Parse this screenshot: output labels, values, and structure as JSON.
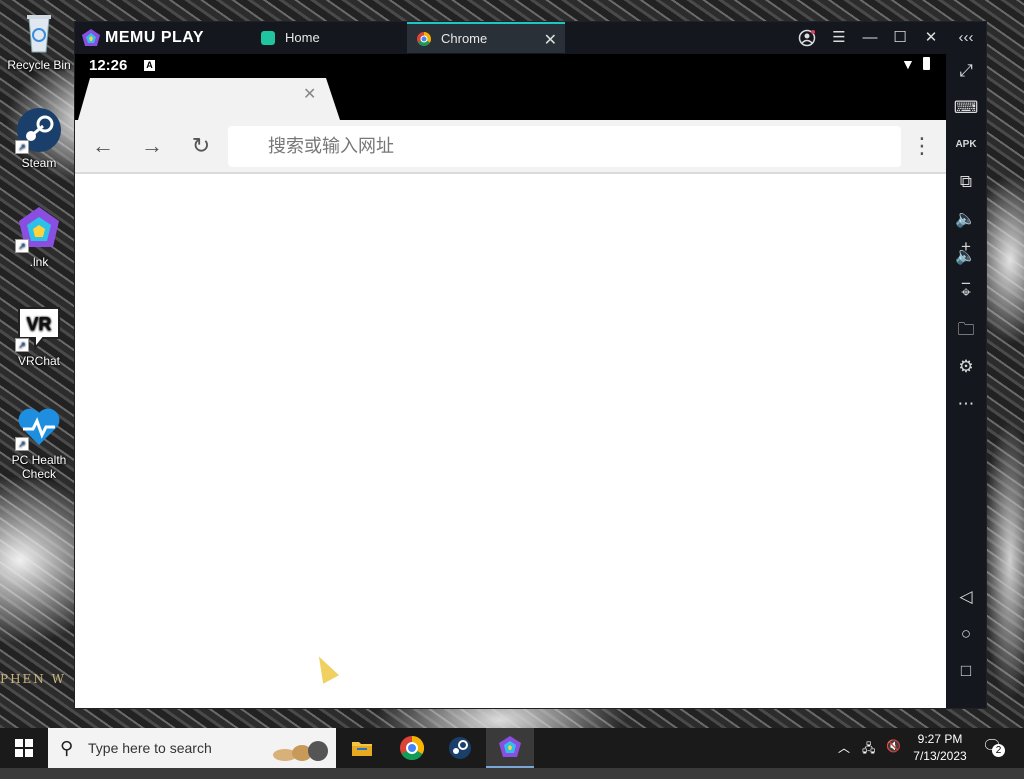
{
  "desktop": {
    "icons": [
      {
        "label": "Recycle Bin"
      },
      {
        "label": "Steam"
      },
      {
        "label": ".lnk"
      },
      {
        "label": "VRChat"
      },
      {
        "label": "PC Health Check"
      }
    ],
    "wallpaper_text": "PHEN W"
  },
  "memu": {
    "logo_text": "MEMU PLAY",
    "tabs": [
      {
        "label": "Home",
        "active": false
      },
      {
        "label": "Chrome",
        "active": true
      }
    ],
    "accent_color": "#20c5c5"
  },
  "android": {
    "status_time": "12:26",
    "chrome": {
      "omnibox_placeholder": "搜索或输入网址"
    }
  },
  "sidebar": {
    "buttons": [
      "fullscreen-icon",
      "keyboard-icon",
      "apk-icon",
      "multi-window-icon",
      "volume-up-icon",
      "volume-down-icon",
      "location-icon",
      "folder-icon",
      "settings-icon",
      "more-icon",
      "back-icon",
      "home-icon",
      "recents-icon"
    ],
    "apk_label": "APK"
  },
  "taskbar": {
    "search_placeholder": "Type here to search",
    "clock_time": "9:27 PM",
    "clock_date": "7/13/2023",
    "notification_count": "2"
  }
}
